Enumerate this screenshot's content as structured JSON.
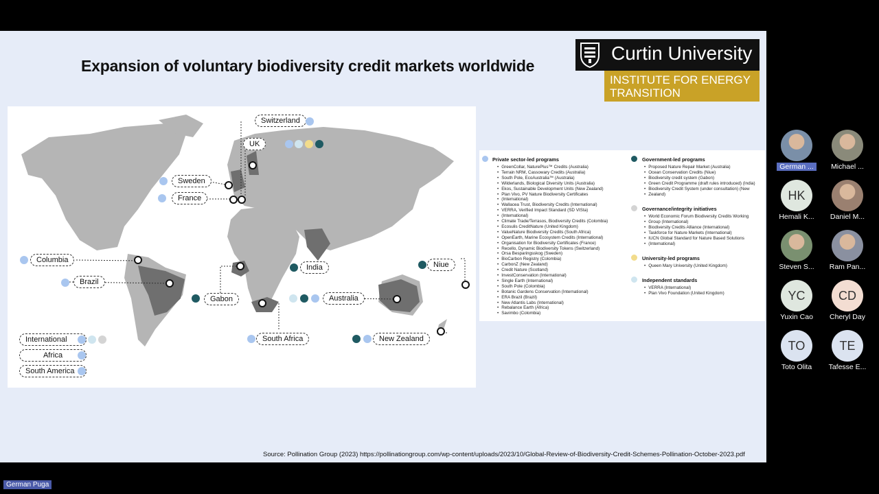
{
  "slide": {
    "title": "Expansion of voluntary biodiversity credit markets worldwide",
    "logo": {
      "name": "Curtin University",
      "institute_line1": "INSTITUTE FOR ENERGY",
      "institute_line2": "TRANSITION"
    },
    "source": "Source: Pollination Group (2023) https://pollinationgroup.com/wp-content/uploads/2023/10/Global-Review-of-Biodiversity-Credit-Schemes-Pollination-October-2023.pdf"
  },
  "colors": {
    "private": "#a9c6ef",
    "government": "#1f5a62",
    "governance": "#d4d4d4",
    "university": "#f2dc8c",
    "independent": "#cfe5ef"
  },
  "map_labels": {
    "switzerland": "Switzerland",
    "uk": "UK",
    "sweden": "Sweden",
    "france": "France",
    "columbia": "Columbia",
    "brazil": "Brazil",
    "gabon": "Gabon",
    "india": "India",
    "niue": "Niue",
    "australia": "Australia",
    "south_africa": "South Africa",
    "new_zealand": "New Zealand",
    "international": "International",
    "africa": "Africa",
    "south_america": "South America"
  },
  "legend": {
    "private": {
      "heading": "Private sector-led programs",
      "items": [
        "GreenCollar, NaturePlus™ Credits (Australia)",
        "Terrain NRM, Cassowary Credits (Australia)",
        "South Pole, EcoAustralia™ (Australia)",
        "Wilderlands, Biological Diversity Units (Australia)",
        "Ekos, Sustainable Development Units (New Zealand)",
        "Plan Vivo, PV Nature Biodiversity Certificates",
        "(International)",
        "Wallacea Trust, Biodiversity Credits (International)",
        "VERRA, Verified Impact Standard (SD VISta)",
        "(International)",
        "Climate Trade/Terrasos, Biodiversity Credits (Colombia)",
        "Ecosulis CreditNature (United Kingdom)",
        "ValueNature Biodiversity Credits (South Africa)",
        "OpenEarth, Marine Ecosystem Credits (International)",
        "Organisation for Biodiversity Certificates (France)",
        "Recello, Dynamic Biodiversity Tokens (Switzerland)",
        "Orsa Besparingsskog (Sweden)",
        "BioCarbon Registry (Colombia)",
        "CarbonZ (New Zealand)",
        "Credit Nature (Scotland)",
        "InvestConservation (International)",
        "Single Earth (International)",
        "South Pole (Colombia)",
        "Botanic Gardens Conservation (International)",
        "ERA Brazil (Brazil)",
        "New Atlantis Labs (International)",
        "Rebalance Earth (Africa)",
        "Savimbo (Colombia)"
      ]
    },
    "government": {
      "heading": "Government-led programs",
      "items": [
        "Proposed Nature Repair Market (Australia)",
        "Ocean Conservation Credits (Niue)",
        "Biodiversity credit system (Gabon)",
        "Green Credit Programme (draft rules introduced) (India)",
        "Biodiversity Credit System (under consultation) (New",
        "Zealand)"
      ]
    },
    "governance": {
      "heading": "Governance/integrity initiatives",
      "items": [
        "World Economic Forum Biodiversity Credits Working",
        "Group (International)",
        "Biodiversity Credits Alliance (International)",
        "Taskforce for Nature Markets (International)",
        "IUCN Global Standard for Nature Based Solutions",
        "(International)"
      ]
    },
    "university": {
      "heading": "University-led programs",
      "items": [
        "Queen Mary University (United Kingdom)"
      ]
    },
    "independent": {
      "heading": "Independent standards",
      "items": [
        "VERRA (International)",
        "Plan Vivo Foundation (United Kingdom)"
      ]
    }
  },
  "participants": [
    {
      "name": "German ...",
      "initials": ""
    },
    {
      "name": "Michael ...",
      "initials": ""
    },
    {
      "name": "Hemali K...",
      "initials": "HK"
    },
    {
      "name": "Daniel M...",
      "initials": ""
    },
    {
      "name": "Steven S...",
      "initials": ""
    },
    {
      "name": "Ram Pan...",
      "initials": ""
    },
    {
      "name": "Yuxin Cao",
      "initials": "YC"
    },
    {
      "name": "Cheryl Day",
      "initials": "CD"
    },
    {
      "name": "Toto Olita",
      "initials": "TO"
    },
    {
      "name": "Tafesse E...",
      "initials": "TE"
    }
  ],
  "self_name": "German Puga"
}
